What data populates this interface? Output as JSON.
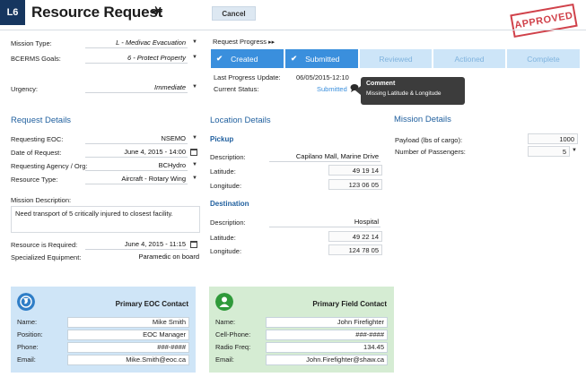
{
  "header": {
    "badge": "L6",
    "title": "Resource Request",
    "cancel_label": "Cancel",
    "stamp": "APPROVED"
  },
  "left_top": {
    "mission_type_label": "Mission Type:",
    "mission_type_value": "L - Medivac Evacuation",
    "bcerms_label": "BCERMS Goals:",
    "bcerms_value": "6 - Protect Property",
    "urgency_label": "Urgency:",
    "urgency_value": "Immediate"
  },
  "progress": {
    "label": "Request Progress",
    "arrows": "▸▸",
    "steps": [
      {
        "label": "Created",
        "done": true
      },
      {
        "label": "Submitted",
        "done": true
      },
      {
        "label": "Reviewed",
        "done": false
      },
      {
        "label": "Actioned",
        "done": false
      },
      {
        "label": "Complete",
        "done": false
      }
    ],
    "last_update_label": "Last Progress Update:",
    "last_update_value": "06/05/2015-12:10",
    "current_status_label": "Current Status:",
    "current_status_value": "Submitted"
  },
  "tooltip": {
    "title": "Comment",
    "body": "Missing Latitude & Longitude"
  },
  "request_details": {
    "heading": "Request Details",
    "eoc_label": "Requesting EOC:",
    "eoc_value": "NSEMO",
    "date_label": "Date of Request:",
    "date_value": "June 4, 2015 - 14:00",
    "agency_label": "Requesting Agency / Org:",
    "agency_value": "BCHydro",
    "resource_type_label": "Resource Type:",
    "resource_type_value": "Aircraft - Rotary Wing",
    "mission_desc_label": "Mission Description:",
    "mission_desc_value": "Need transport of 5 critically injured to closest facility.",
    "required_label": "Resource is Required:",
    "required_value": "June 4, 2015 - 11:15",
    "equipment_label": "Specialized Equipment:",
    "equipment_value": "Paramedic on board"
  },
  "location_details": {
    "heading": "Location Details",
    "pickup_heading": "Pickup",
    "pickup_desc_label": "Description:",
    "pickup_desc_value": "Capilano Mall, Marine Drive",
    "pickup_lat_label": "Latitude:",
    "pickup_lat_value": "49 19 14",
    "pickup_lon_label": "Longitude:",
    "pickup_lon_value": "123 06 05",
    "dest_heading": "Destination",
    "dest_desc_label": "Description:",
    "dest_desc_value": "Hospital",
    "dest_lat_label": "Latitude:",
    "dest_lat_value": "49 22 14",
    "dest_lon_label": "Longitude:",
    "dest_lon_value": "124 78 05"
  },
  "mission_details": {
    "heading": "Mission Details",
    "payload_label": "Payload (lbs of cargo):",
    "payload_value": "1000",
    "passengers_label": "Number of Passengers:",
    "passengers_value": "5"
  },
  "eoc_contact": {
    "title": "Primary EOC Contact",
    "rows": [
      {
        "label": "Name:",
        "value": "Mike Smith"
      },
      {
        "label": "Position:",
        "value": "EOC Manager"
      },
      {
        "label": "Phone:",
        "value": "###-####"
      },
      {
        "label": "Email:",
        "value": "Mike.Smith@eoc.ca"
      }
    ]
  },
  "field_contact": {
    "title": "Primary Field Contact",
    "rows": [
      {
        "label": "Name:",
        "value": "John Firefighter"
      },
      {
        "label": "Cell-Phone:",
        "value": "###-####"
      },
      {
        "label": "Radio Freq:",
        "value": "134.45"
      },
      {
        "label": "Email:",
        "value": "John.Firefighter@shaw.ca"
      }
    ]
  },
  "colors": {
    "accent": "#3a8fdd",
    "header_badge": "#16365f",
    "stamp": "#c8212b",
    "eoc_card": "#cfe5f7",
    "field_card": "#d5ecd3"
  },
  "icons": {
    "header": "airplane-icon",
    "eoc": "globe-icon",
    "field": "person-icon"
  }
}
